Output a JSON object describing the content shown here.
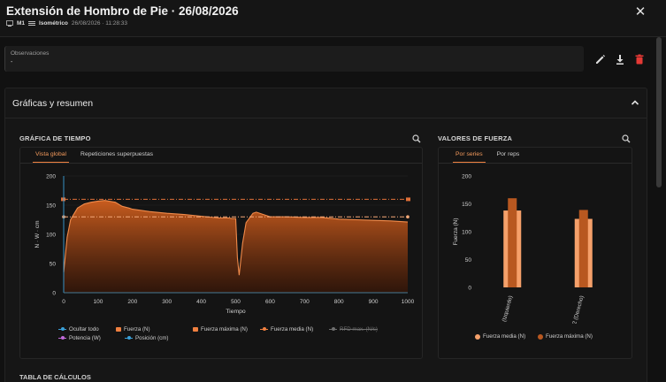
{
  "header": {
    "title": "Extensión de Hombro de Pie · 26/08/2026",
    "device": "M1",
    "mode": "Isométrico",
    "datetime": "26/08/2026 · 11:28:33"
  },
  "observations": {
    "label": "Observaciones",
    "value": "-"
  },
  "section": {
    "title": "Gráficas y resumen"
  },
  "time_chart": {
    "caption": "GRÁFICA DE TIEMPO",
    "tabs": [
      "Vista global",
      "Repeticiones superpuestas"
    ],
    "active_tab": "Vista global",
    "legend": [
      {
        "label": "Ocultar todo",
        "color": "#3aa0d8",
        "marker": "line",
        "visible": true
      },
      {
        "label": "Fuerza (N)",
        "color": "#f08040",
        "marker": "square",
        "visible": true
      },
      {
        "label": "Fuerza máxima (N)",
        "color": "#f08040",
        "marker": "square",
        "visible": true
      },
      {
        "label": "Fuerza media (N)",
        "color": "#f08040",
        "marker": "line",
        "visible": true
      },
      {
        "label": "RFD max. (N/s)",
        "color": "#6f6f6f",
        "marker": "line",
        "visible": false
      },
      {
        "label": "Potencia (W)",
        "color": "#c06ad8",
        "marker": "line",
        "visible": true
      },
      {
        "label": "Posición (cm)",
        "color": "#3aa0d8",
        "marker": "line",
        "visible": true
      }
    ]
  },
  "force_values": {
    "caption": "VALORES DE FUERZA",
    "tabs": [
      "Por series",
      "Por reps"
    ],
    "active_tab": "Por series",
    "legend": [
      "Fuerza media (N)",
      "Fuerza máxima (N)"
    ]
  },
  "table": {
    "caption": "TABLA DE CÁLCULOS"
  },
  "chart_data": [
    {
      "type": "area",
      "xlabel": "Tiempo",
      "ylabel": "N · W · cm",
      "xlim": [
        0,
        1000
      ],
      "ylim": [
        0,
        200
      ],
      "xticks": [
        0,
        100,
        200,
        300,
        400,
        500,
        600,
        700,
        800,
        900,
        1000
      ],
      "yticks": [
        0,
        50,
        100,
        150,
        200
      ],
      "series": [
        {
          "name": "Fuerza (N)",
          "x": [
            0,
            10,
            20,
            40,
            60,
            80,
            100,
            120,
            150,
            170,
            190,
            200,
            250,
            300,
            350,
            400,
            450,
            480,
            490,
            500,
            505,
            510,
            520,
            530,
            550,
            560,
            600,
            650,
            700,
            750,
            800,
            850,
            900,
            950,
            1000
          ],
          "y": [
            35,
            95,
            125,
            145,
            152,
            155,
            157,
            158,
            155,
            148,
            145,
            143,
            139,
            136,
            134,
            131,
            128,
            128,
            127,
            127,
            60,
            30,
            85,
            120,
            136,
            138,
            130,
            130,
            129,
            129,
            126,
            125,
            124,
            123,
            121
          ]
        },
        {
          "name": "Fuerza máxima (N)",
          "x": [
            0,
            1000
          ],
          "y": [
            160,
            160
          ]
        },
        {
          "name": "Fuerza media (N)",
          "x": [
            0,
            1000
          ],
          "y": [
            130,
            130
          ]
        },
        {
          "name": "Posición (cm)",
          "x": [
            0,
            1000
          ],
          "y": [
            0,
            0
          ]
        }
      ]
    },
    {
      "type": "bar",
      "categories": [
        "S1 (Izquierdo)",
        "S2 (Derecho)"
      ],
      "ylabel": "Fuerza (N)",
      "ylim": [
        0,
        200
      ],
      "yticks": [
        0,
        50,
        100,
        150,
        200
      ],
      "series": [
        {
          "name": "Fuerza media (N)",
          "values": [
            138,
            123
          ]
        },
        {
          "name": "Fuerza máxima (N)",
          "values": [
            160,
            139
          ]
        }
      ]
    }
  ]
}
